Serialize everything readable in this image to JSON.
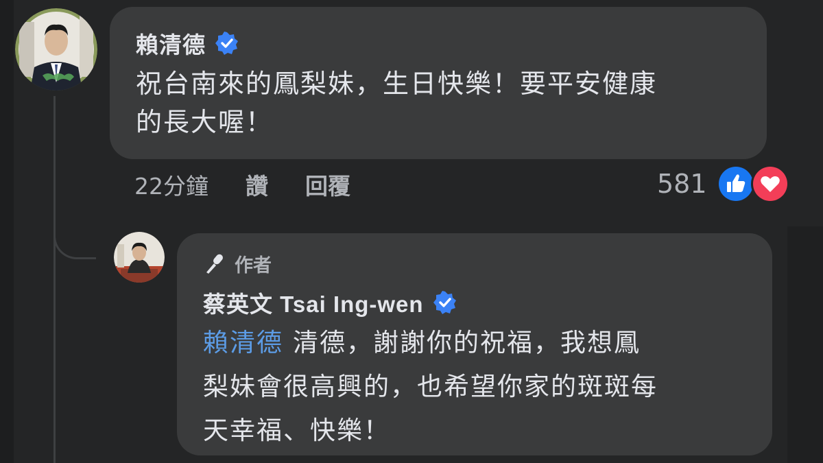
{
  "comment": {
    "author": "賴清德",
    "text_line1": "祝台南來的鳳梨妹，生日快樂！要平安健康",
    "text_line2": "的長大喔！",
    "time": "22分鐘",
    "like_action": "讚",
    "reply_action": "回覆",
    "reaction_count": "581",
    "reaction_icons": [
      "like-icon",
      "love-icon"
    ]
  },
  "reply": {
    "badge": "作者",
    "author": "蔡英文 Tsai Ing-wen",
    "mention": "賴清德",
    "text_line1": "清德，謝謝你的祝福，我想鳳",
    "text_line2": "梨妹會很高興的，也希望你家的斑斑每",
    "text_line3": "天幸福、快樂！"
  },
  "colors": {
    "background": "#242526",
    "bubble": "#3a3b3c",
    "mention": "#5c9ce6",
    "verified": "#3b82f6",
    "like": "#1877f2",
    "love": "#f33e58"
  }
}
